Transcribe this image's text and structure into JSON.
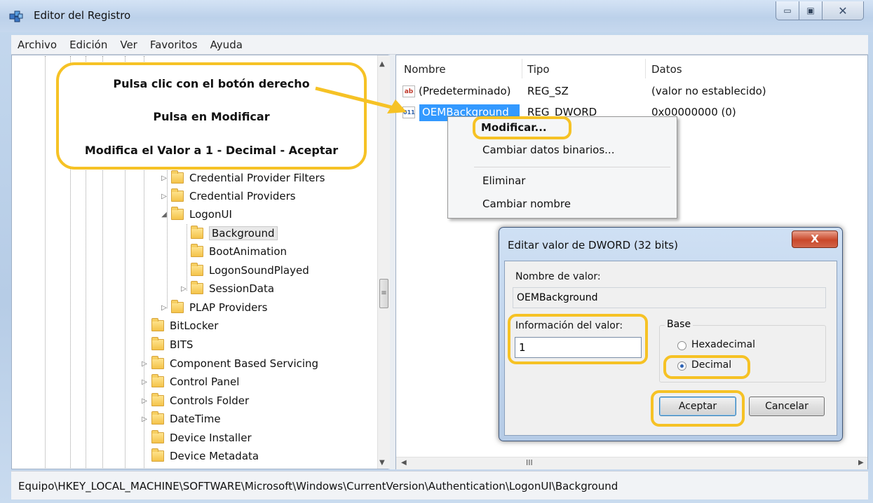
{
  "window": {
    "title": "Editor del Registro"
  },
  "menubar": [
    "Archivo",
    "Edición",
    "Ver",
    "Favoritos",
    "Ayuda"
  ],
  "tree": {
    "items": [
      {
        "label": "Credential Provider Filters",
        "expander": "▷"
      },
      {
        "label": "Credential Providers",
        "expander": "▷"
      },
      {
        "label": "LogonUI",
        "expander": "◢"
      },
      {
        "label": "Background",
        "expander": ""
      },
      {
        "label": "BootAnimation",
        "expander": ""
      },
      {
        "label": "LogonSoundPlayed",
        "expander": ""
      },
      {
        "label": "SessionData",
        "expander": "▷"
      },
      {
        "label": "PLAP Providers",
        "expander": "▷"
      },
      {
        "label": "BitLocker",
        "expander": ""
      },
      {
        "label": "BITS",
        "expander": ""
      },
      {
        "label": "Component Based Servicing",
        "expander": "▷"
      },
      {
        "label": "Control Panel",
        "expander": "▷"
      },
      {
        "label": "Controls Folder",
        "expander": "▷"
      },
      {
        "label": "DateTime",
        "expander": "▷"
      },
      {
        "label": "Device Installer",
        "expander": ""
      },
      {
        "label": "Device Metadata",
        "expander": ""
      }
    ]
  },
  "list": {
    "columns": [
      "Nombre",
      "Tipo",
      "Datos"
    ],
    "rows": [
      {
        "icon": "ab",
        "name": "(Predeterminado)",
        "type": "REG_SZ",
        "data": "(valor no establecido)"
      },
      {
        "icon": "011",
        "name": "OEMBackground",
        "type": "REG_DWORD",
        "data": "0x00000000 (0)"
      }
    ]
  },
  "context_menu": [
    "Modificar...",
    "Cambiar datos binarios...",
    "Eliminar",
    "Cambiar nombre"
  ],
  "dialog": {
    "title": "Editar valor de DWORD (32 bits)",
    "close": "X",
    "value_name_label": "Nombre de valor:",
    "value_name": "OEMBackground",
    "value_data_label": "Información del valor:",
    "value_data": "1",
    "base_label": "Base",
    "hex_label": "Hexadecimal",
    "dec_label": "Decimal",
    "ok": "Aceptar",
    "cancel": "Cancelar"
  },
  "callout": {
    "line1": "Pulsa clic con el botón derecho",
    "line2": "Pulsa en Modificar",
    "line3": "Modifica el Valor a 1  - Decimal  - Aceptar"
  },
  "scrollbar": {
    "grip": "≡",
    "hgrip": "III"
  },
  "status": "Equipo\\HKEY_LOCAL_MACHINE\\SOFTWARE\\Microsoft\\Windows\\CurrentVersion\\Authentication\\LogonUI\\Background",
  "colors": {
    "highlight": "#f6c225",
    "selection": "#3399ff",
    "dialog_close": "#c9482a"
  }
}
